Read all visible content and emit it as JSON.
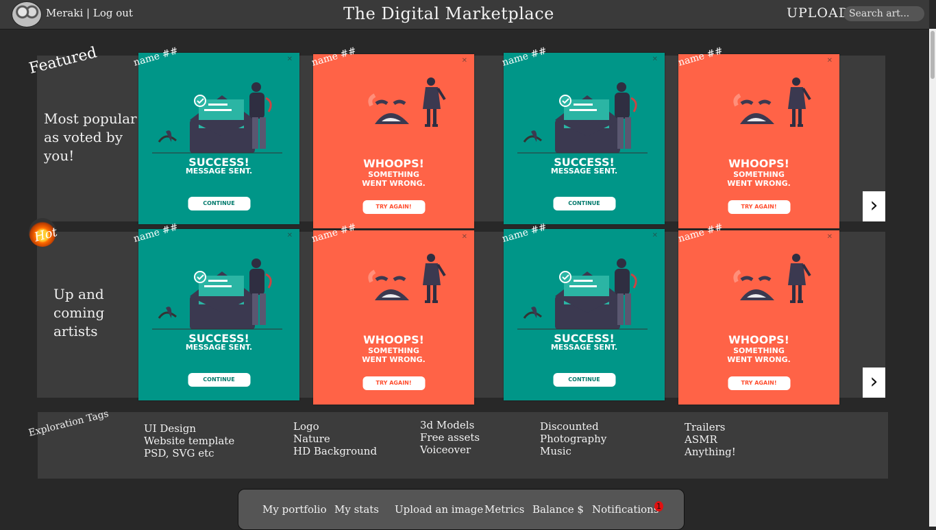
{
  "header": {
    "user_name": "Meraki",
    "separator": "|",
    "logout_label": "Log out",
    "title": "The Digital Marketplace",
    "upload_label": "UPLOAD",
    "search_placeholder": "Search art..."
  },
  "featured": {
    "tag": "Featured",
    "description": "Most popular as voted by you!",
    "cards": [
      {
        "name": "name ##",
        "variant": "success",
        "headline": "SUCCESS!",
        "subline1": "MESSAGE SENT.",
        "subline2": "",
        "button": "CONTINUE"
      },
      {
        "name": "name ##",
        "variant": "fail",
        "headline": "WHOOPS!",
        "subline1": "SOMETHING",
        "subline2": "WENT WRONG.",
        "button": "TRY AGAIN!"
      },
      {
        "name": "name ##",
        "variant": "success",
        "headline": "SUCCESS!",
        "subline1": "MESSAGE SENT.",
        "subline2": "",
        "button": "CONTINUE"
      },
      {
        "name": "name ##",
        "variant": "fail",
        "headline": "WHOOPS!",
        "subline1": "SOMETHING",
        "subline2": "WENT WRONG.",
        "button": "TRY AGAIN!"
      }
    ],
    "next_icon": "chevron-right-icon"
  },
  "hot": {
    "tag": "Hot",
    "description": "Up and coming artists",
    "cards": [
      {
        "name": "name ##",
        "variant": "success",
        "headline": "SUCCESS!",
        "subline1": "MESSAGE SENT.",
        "subline2": "",
        "button": "CONTINUE"
      },
      {
        "name": "name ##",
        "variant": "fail",
        "headline": "WHOOPS!",
        "subline1": "SOMETHING",
        "subline2": "WENT WRONG.",
        "button": "TRY AGAIN!"
      },
      {
        "name": "name ##",
        "variant": "success",
        "headline": "SUCCESS!",
        "subline1": "MESSAGE SENT.",
        "subline2": "",
        "button": "CONTINUE"
      },
      {
        "name": "name ##",
        "variant": "fail",
        "headline": "WHOOPS!",
        "subline1": "SOMETHING",
        "subline2": "WENT WRONG.",
        "button": "TRY AGAIN!"
      }
    ],
    "next_icon": "chevron-right-icon"
  },
  "exploration": {
    "title": "Exploration Tags",
    "columns": [
      [
        "UI Design",
        "Website template",
        "PSD, SVG etc"
      ],
      [
        "Logo",
        "Nature",
        "HD Background"
      ],
      [
        "3d Models",
        "Free assets",
        "Voiceover"
      ],
      [
        "Discounted",
        "Photography",
        "Music"
      ],
      [
        "Trailers",
        "ASMR",
        "Anything!"
      ]
    ]
  },
  "bottom_nav": {
    "portfolio": "My portfolio",
    "stats": "My stats",
    "upload": "Upload an image",
    "metrics": "Metrics",
    "balance": "Balance $",
    "notifications": "Notifications",
    "notification_count": "1"
  },
  "colors": {
    "background": "#282828",
    "band": "#3c3c3c",
    "success_card": "#009688",
    "fail_card": "#ff6347"
  }
}
